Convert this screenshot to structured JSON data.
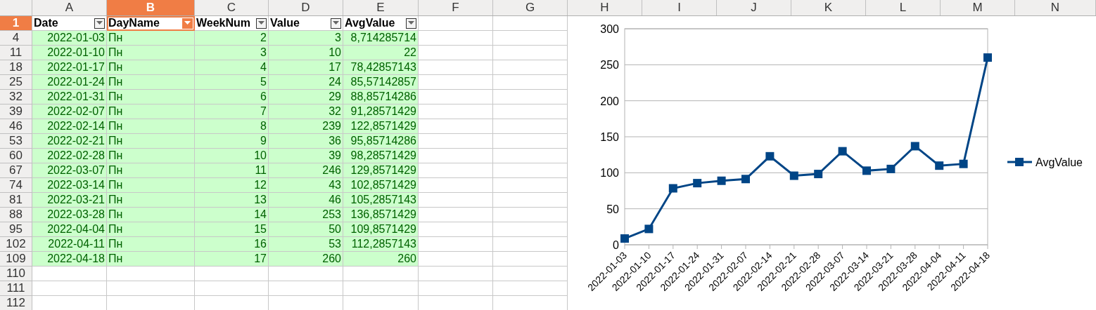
{
  "column_headers": [
    {
      "label": "A",
      "selected": false
    },
    {
      "label": "B",
      "selected": true
    },
    {
      "label": "C",
      "selected": false
    },
    {
      "label": "D",
      "selected": false
    },
    {
      "label": "E",
      "selected": false
    },
    {
      "label": "F",
      "selected": false
    },
    {
      "label": "G",
      "selected": false
    },
    {
      "label": "H",
      "selected": false
    },
    {
      "label": "I",
      "selected": false
    },
    {
      "label": "J",
      "selected": false
    },
    {
      "label": "K",
      "selected": false
    },
    {
      "label": "L",
      "selected": false
    },
    {
      "label": "M",
      "selected": false
    },
    {
      "label": "N",
      "selected": false
    }
  ],
  "header_row": {
    "row_number": "1",
    "selected": true,
    "cells": [
      {
        "label": "Date",
        "filter_active": false
      },
      {
        "label": "DayName",
        "filter_active": true
      },
      {
        "label": "WeekNum",
        "filter_active": false
      },
      {
        "label": "Value",
        "filter_active": false
      },
      {
        "label": "AvgValue",
        "filter_active": false
      }
    ]
  },
  "rows": [
    {
      "row_number": "4",
      "date": "2022-01-03",
      "day": "Пн",
      "week": "2",
      "value": "3",
      "avg": "8,714285714"
    },
    {
      "row_number": "11",
      "date": "2022-01-10",
      "day": "Пн",
      "week": "3",
      "value": "10",
      "avg": "22"
    },
    {
      "row_number": "18",
      "date": "2022-01-17",
      "day": "Пн",
      "week": "4",
      "value": "17",
      "avg": "78,42857143"
    },
    {
      "row_number": "25",
      "date": "2022-01-24",
      "day": "Пн",
      "week": "5",
      "value": "24",
      "avg": "85,57142857"
    },
    {
      "row_number": "32",
      "date": "2022-01-31",
      "day": "Пн",
      "week": "6",
      "value": "29",
      "avg": "88,85714286"
    },
    {
      "row_number": "39",
      "date": "2022-02-07",
      "day": "Пн",
      "week": "7",
      "value": "32",
      "avg": "91,28571429"
    },
    {
      "row_number": "46",
      "date": "2022-02-14",
      "day": "Пн",
      "week": "8",
      "value": "239",
      "avg": "122,8571429"
    },
    {
      "row_number": "53",
      "date": "2022-02-21",
      "day": "Пн",
      "week": "9",
      "value": "36",
      "avg": "95,85714286"
    },
    {
      "row_number": "60",
      "date": "2022-02-28",
      "day": "Пн",
      "week": "10",
      "value": "39",
      "avg": "98,28571429"
    },
    {
      "row_number": "67",
      "date": "2022-03-07",
      "day": "Пн",
      "week": "11",
      "value": "246",
      "avg": "129,8571429"
    },
    {
      "row_number": "74",
      "date": "2022-03-14",
      "day": "Пн",
      "week": "12",
      "value": "43",
      "avg": "102,8571429"
    },
    {
      "row_number": "81",
      "date": "2022-03-21",
      "day": "Пн",
      "week": "13",
      "value": "46",
      "avg": "105,2857143"
    },
    {
      "row_number": "88",
      "date": "2022-03-28",
      "day": "Пн",
      "week": "14",
      "value": "253",
      "avg": "136,8571429"
    },
    {
      "row_number": "95",
      "date": "2022-04-04",
      "day": "Пн",
      "week": "15",
      "value": "50",
      "avg": "109,8571429"
    },
    {
      "row_number": "102",
      "date": "2022-04-11",
      "day": "Пн",
      "week": "16",
      "value": "53",
      "avg": "112,2857143"
    },
    {
      "row_number": "109",
      "date": "2022-04-18",
      "day": "Пн",
      "week": "17",
      "value": "260",
      "avg": "260"
    }
  ],
  "empty_rows": [
    "110",
    "111",
    "112"
  ],
  "chart": {
    "chart_data": {
      "type": "line",
      "categories": [
        "2022-01-03",
        "2022-01-10",
        "2022-01-17",
        "2022-01-24",
        "2022-01-31",
        "2022-02-07",
        "2022-02-14",
        "2022-02-21",
        "2022-02-28",
        "2022-03-07",
        "2022-03-14",
        "2022-03-21",
        "2022-03-28",
        "2022-04-04",
        "2022-04-11",
        "2022-04-18"
      ],
      "series": [
        {
          "name": "AvgValue",
          "color": "#004586",
          "marker": "square",
          "values": [
            8.7,
            22,
            78.4,
            85.6,
            88.9,
            91.3,
            122.9,
            95.9,
            98.3,
            129.9,
            102.9,
            105.3,
            136.9,
            109.9,
            112.3,
            260
          ]
        }
      ],
      "grid": true,
      "ylim": [
        0,
        300
      ],
      "yticks": [
        0,
        50,
        100,
        150,
        200,
        250,
        300
      ]
    }
  }
}
